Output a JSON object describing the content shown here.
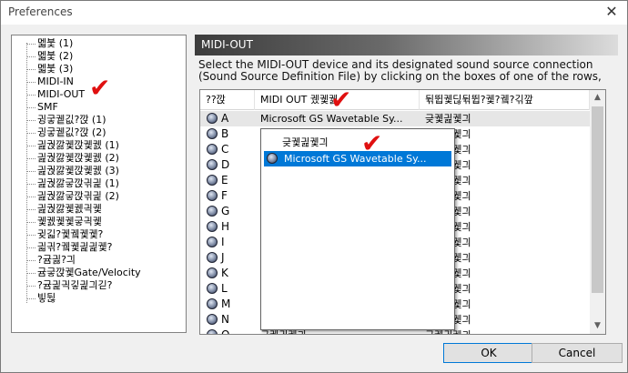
{
  "window": {
    "title": "Preferences",
    "close_glyph": "✕"
  },
  "tree": {
    "items": [
      "멟붗 (1)",
      "멟붗 (2)",
      "멟붗 (3)",
      "MIDI-IN",
      "MIDI-OUT",
      "SMF",
      "귕궇궽깂?깑 (1)",
      "귕궇궽깂?깑 (2)",
      "긢궍깛궻깑궻궰 (1)",
      "긢궍깛궻깑궻궰 (2)",
      "긢궍깛궻깑궻궰 (3)",
      "긢궍깛긓깑긖긡 (1)",
      "긢궍깛긓깑긖긡 (2)",
      "긢궍깛궻궰긕궻",
      "궻궰궻궻긓긕궻",
      "귖긻?궻궼궻궻?",
      "긟긖?궼궻긡긡궻?",
      "?귬긣?긔",
      "귬긓깑궻Gate/Velocity",
      "?귬긡긕깋긡긔긷?",
      "빟뒪"
    ]
  },
  "panel": {
    "header": "MIDI-OUT",
    "description_line1": "Select the MIDI-OUT device and its designated sound source connection",
    "description_line2": "(Sound Source Definition File) by clicking on the boxes of one of the rows,"
  },
  "table": {
    "columns": [
      "??깑",
      "MIDI OUT 궸궻궰",
      "뒦뜁궻딚뒦뜁?궻?궼?긲깦"
    ],
    "rows": [
      {
        "port": "A",
        "device": "Microsoft GS Wavetable Sy...",
        "source": "긎궻긢궻긔"
      },
      {
        "port": "B",
        "device": "",
        "source": "긎궻긢궻긔"
      },
      {
        "port": "C",
        "device": "",
        "source": "긎궻긢궻긔"
      },
      {
        "port": "D",
        "device": "",
        "source": "긎궻긢궻긔"
      },
      {
        "port": "E",
        "device": "",
        "source": "긎궻긢궻긔"
      },
      {
        "port": "F",
        "device": "",
        "source": "긎궻긢궻긔"
      },
      {
        "port": "G",
        "device": "",
        "source": "긎궻긢궻긔"
      },
      {
        "port": "H",
        "device": "",
        "source": "긎궻긢궻긔"
      },
      {
        "port": "I",
        "device": "",
        "source": "긎궻긢궻긔"
      },
      {
        "port": "J",
        "device": "",
        "source": "긎궻긢궻긔"
      },
      {
        "port": "K",
        "device": "",
        "source": "긎궻긢궻긔"
      },
      {
        "port": "L",
        "device": "",
        "source": "긎궻긢궻긔"
      },
      {
        "port": "M",
        "device": "",
        "source": "긎궻긢궻긔"
      },
      {
        "port": "N",
        "device": "",
        "source": "긎궻긢궻긔"
      },
      {
        "port": "O",
        "device": "긎궻긢궻긔",
        "source": "긎궻긢궻긔"
      }
    ]
  },
  "dropdown": {
    "options": [
      "긎궻긢궻긔",
      "Microsoft GS Wavetable Sy..."
    ],
    "selected_index": 1
  },
  "scrollbar": {
    "up": "▲",
    "down": "▼"
  },
  "buttons": {
    "ok": "OK",
    "cancel": "Cancel"
  },
  "annotations": {
    "check_glyph": "✔",
    "color": "#e01010"
  },
  "colors": {
    "selection": "#0078d7"
  }
}
